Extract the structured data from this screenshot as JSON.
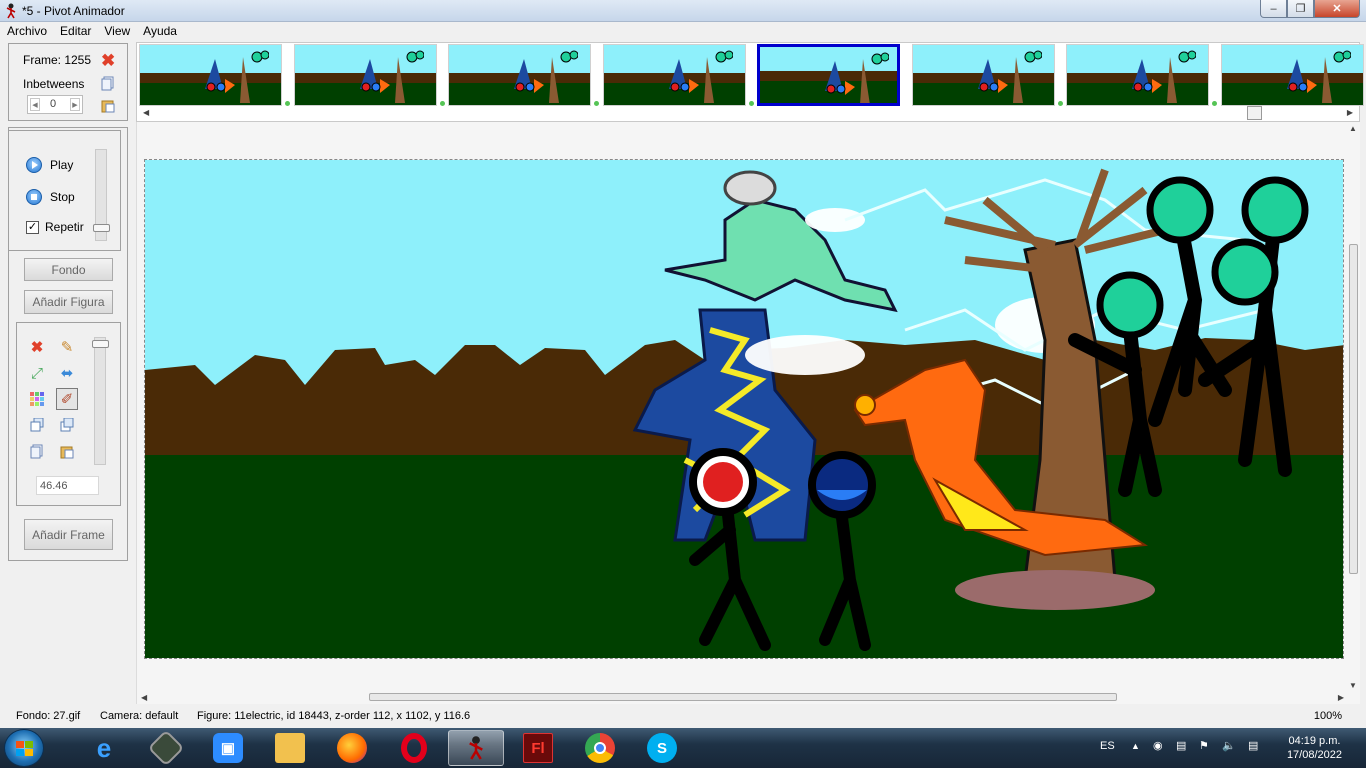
{
  "window": {
    "title": "*5 - Pivot Animador"
  },
  "menu": [
    "Archivo",
    "Editar",
    "View",
    "Ayuda"
  ],
  "frame_panel": {
    "frame_label": "Frame: 1255",
    "inbetweens_label": "Inbetweens",
    "inbetweens_value": "0"
  },
  "playback": {
    "play": "Play",
    "stop": "Stop",
    "repeat": "Repetir",
    "repeat_checked": "✓"
  },
  "buttons": {
    "background": "Fondo",
    "add_figure": "Añadir Figura",
    "add_frame": "Añadir Frame"
  },
  "tools": {
    "size_value": "46.46"
  },
  "frame_strip": {
    "thumbnail_count": 8,
    "selected_index": 4
  },
  "status": {
    "background": "Fondo: 27.gif",
    "camera": "Camera: default",
    "figure": "Figure: 11electric,  id 18443,  z-order 112,  x 1102, y 116.6",
    "zoom": "100%"
  },
  "taskbar": {
    "apps": [
      "internet-explorer",
      "media-player",
      "zoom",
      "file-explorer",
      "firefox",
      "opera",
      "pivot-animator",
      "flash",
      "chrome",
      "skype"
    ],
    "active_app": "pivot-animator",
    "language": "ES",
    "time": "04:19 p.m.",
    "date": "17/08/2022"
  },
  "colors": {
    "sky": "#8ef0fb",
    "ground": "#004000",
    "hills": "#4a2a06",
    "selection": "#0000cc"
  }
}
